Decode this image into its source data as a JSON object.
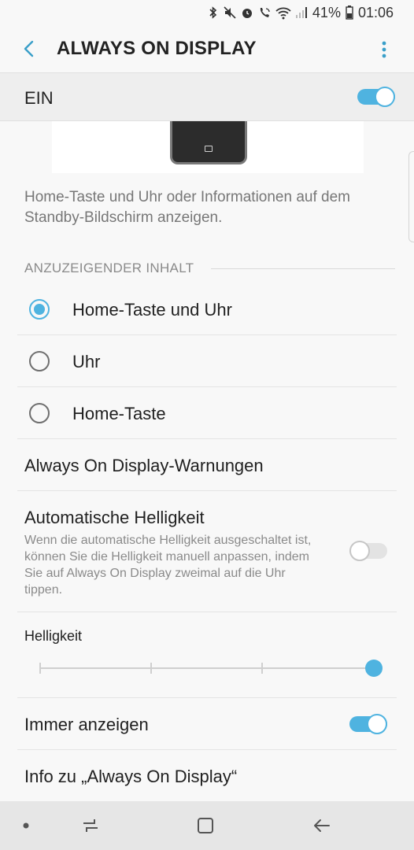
{
  "status_bar": {
    "battery_percent": "41%",
    "time": "01:06",
    "icons": [
      "bluetooth-icon",
      "mute-icon",
      "alarm-icon",
      "wifi-call-icon",
      "wifi-icon",
      "signal-icon",
      "battery-icon"
    ]
  },
  "header": {
    "title": "ALWAYS ON DISPLAY",
    "back_icon": "back-arrow-icon",
    "more_icon": "more-vert-icon"
  },
  "master_switch": {
    "label": "EIN",
    "on": true
  },
  "description": "Home-Taste und Uhr oder Informationen auf dem Standby-Bildschirm anzeigen.",
  "content_section": {
    "header": "ANZUZEIGENDER INHALT",
    "options": [
      {
        "label": "Home-Taste und Uhr",
        "selected": true
      },
      {
        "label": "Uhr",
        "selected": false
      },
      {
        "label": "Home-Taste",
        "selected": false
      }
    ]
  },
  "warnings": {
    "title": "Always On Display-Warnungen"
  },
  "auto_brightness": {
    "title": "Automatische Helligkeit",
    "summary": "Wenn die automatische Helligkeit ausgeschaltet ist, können Sie die Helligkeit manuell anpassen, indem Sie auf Always On Display zweimal auf die Uhr tippen.",
    "on": false
  },
  "brightness": {
    "label": "Helligkeit",
    "level": 1.0,
    "steps": 4
  },
  "always_show": {
    "title": "Immer anzeigen",
    "on": true
  },
  "info": {
    "title": "Info zu „Always On Display“"
  },
  "nav_bar": {
    "icons": [
      "dot-icon",
      "recents-icon",
      "home-icon",
      "back-icon"
    ]
  },
  "colors": {
    "accent": "#4fb3e0",
    "background": "#f8f8f8"
  }
}
